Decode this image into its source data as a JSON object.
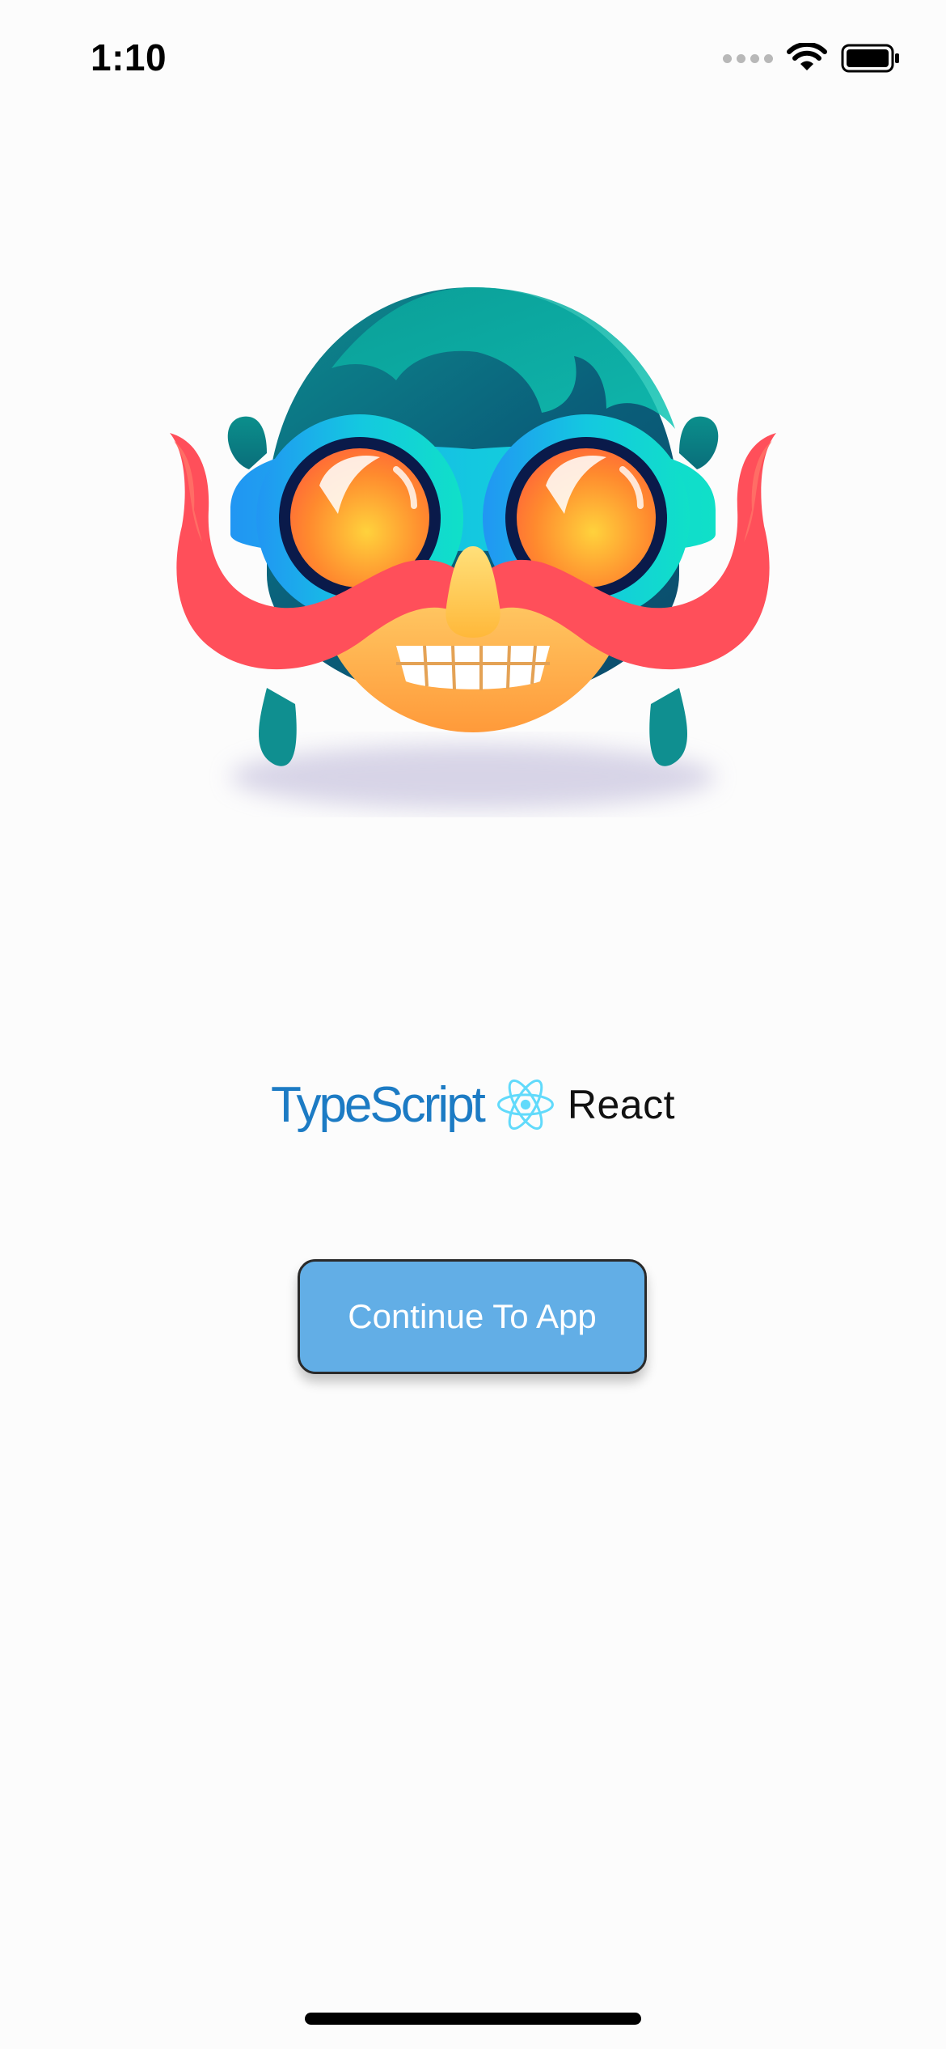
{
  "status_bar": {
    "time": "1:10",
    "icons": [
      "signal-dots-icon",
      "wifi-icon",
      "battery-icon"
    ]
  },
  "mascot": {
    "icon": "mustache-goggles-mascot-logo"
  },
  "brand": {
    "typescript_label": "TypeScript",
    "react_icon": "react-atom-icon",
    "react_label": "React",
    "colors": {
      "typescript": "#1c7bc4",
      "react_atom": "#61dafb",
      "react_text": "#111111"
    }
  },
  "continue_button": {
    "label": "Continue To App",
    "background": "#62aee6",
    "text_color": "#ffffff"
  },
  "theme": {
    "page_background": "#fcfcfc"
  }
}
